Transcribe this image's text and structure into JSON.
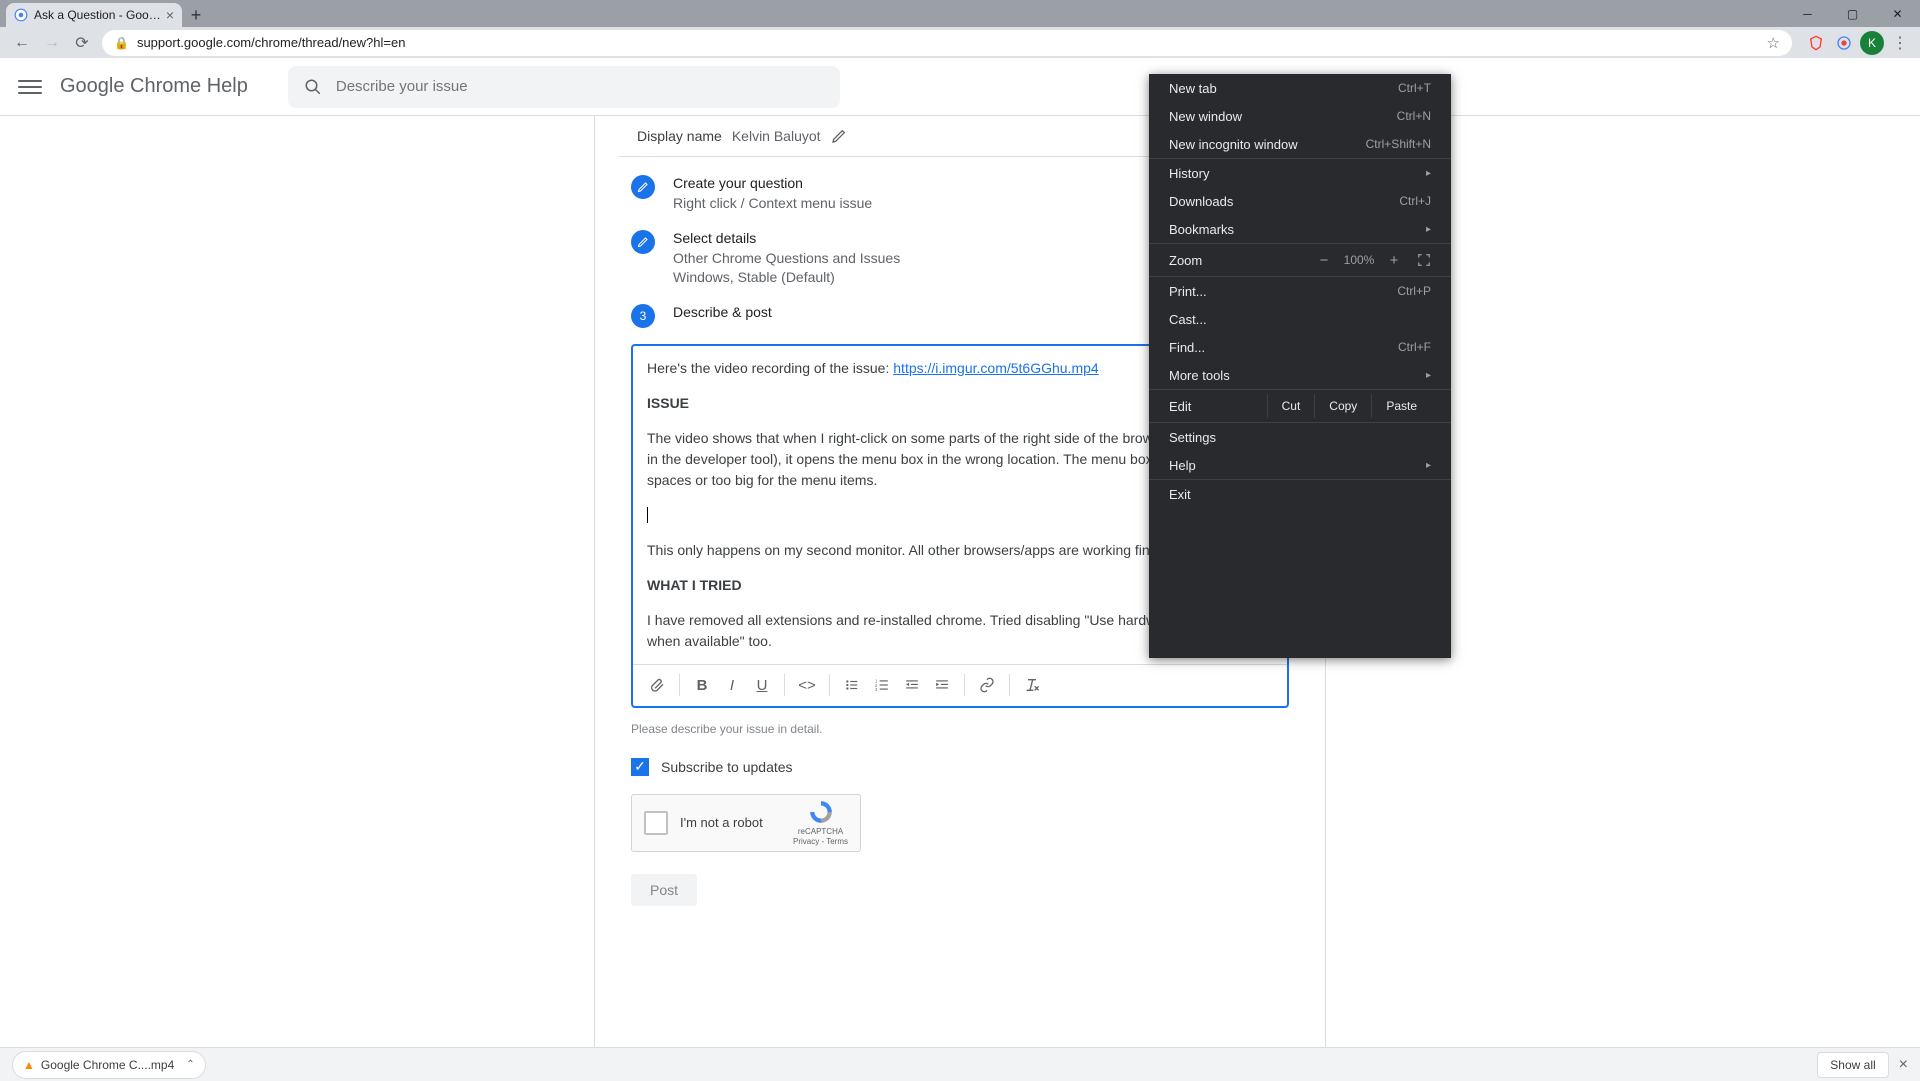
{
  "browser": {
    "tab_title": "Ask a Question - Google Chrome",
    "url": "support.google.com/chrome/thread/new?hl=en",
    "avatar_letter": "K"
  },
  "header": {
    "title": "Google Chrome Help",
    "search_placeholder": "Describe your issue"
  },
  "display_name": {
    "label": "Display name",
    "value": "Kelvin Baluyot"
  },
  "steps": {
    "s1_title": "Create your question",
    "s1_sub": "Right click / Context menu issue",
    "s2_title": "Select details",
    "s2_sub1": "Other Chrome Questions and Issues",
    "s2_sub2": "Windows, Stable (Default)",
    "s3_num": "3",
    "s3_title": "Describe & post"
  },
  "editor": {
    "intro_prefix": "Here's the video recording of the issue: ",
    "intro_link": "https://i.imgur.com/5t6GGhu.mp4",
    "h_issue": "ISSUE",
    "p_issue": "The video shows that when I right-click on some parts of the right side of the browser window (even in the developer tool), it opens the menu box in the wrong location. The menu box also has too much spaces or too big for the menu items.",
    "p_monitor": "This only happens on my second monitor. All other browsers/apps are working fine.",
    "h_tried": "WHAT I TRIED",
    "p_tried": "I have removed all extensions and re-installed chrome. Tried disabling \"Use hardware acceleration when available\" too."
  },
  "hint": "Please describe your issue in detail.",
  "subscribe": "Subscribe to updates",
  "recaptcha": {
    "label": "I'm not a robot",
    "brand": "reCAPTCHA",
    "links": "Privacy - Terms"
  },
  "post": "Post",
  "menu": {
    "newtab": "New tab",
    "newtab_sc": "Ctrl+T",
    "newwin": "New window",
    "newwin_sc": "Ctrl+N",
    "newinc": "New incognito window",
    "newinc_sc": "Ctrl+Shift+N",
    "history": "History",
    "downloads": "Downloads",
    "downloads_sc": "Ctrl+J",
    "bookmarks": "Bookmarks",
    "zoom": "Zoom",
    "zoom_val": "100%",
    "print": "Print...",
    "print_sc": "Ctrl+P",
    "cast": "Cast...",
    "find": "Find...",
    "find_sc": "Ctrl+F",
    "moretools": "More tools",
    "edit": "Edit",
    "cut": "Cut",
    "copy": "Copy",
    "paste": "Paste",
    "settings": "Settings",
    "help": "Help",
    "exit": "Exit"
  },
  "downloads": {
    "file": "Google Chrome C....mp4",
    "showall": "Show all"
  }
}
